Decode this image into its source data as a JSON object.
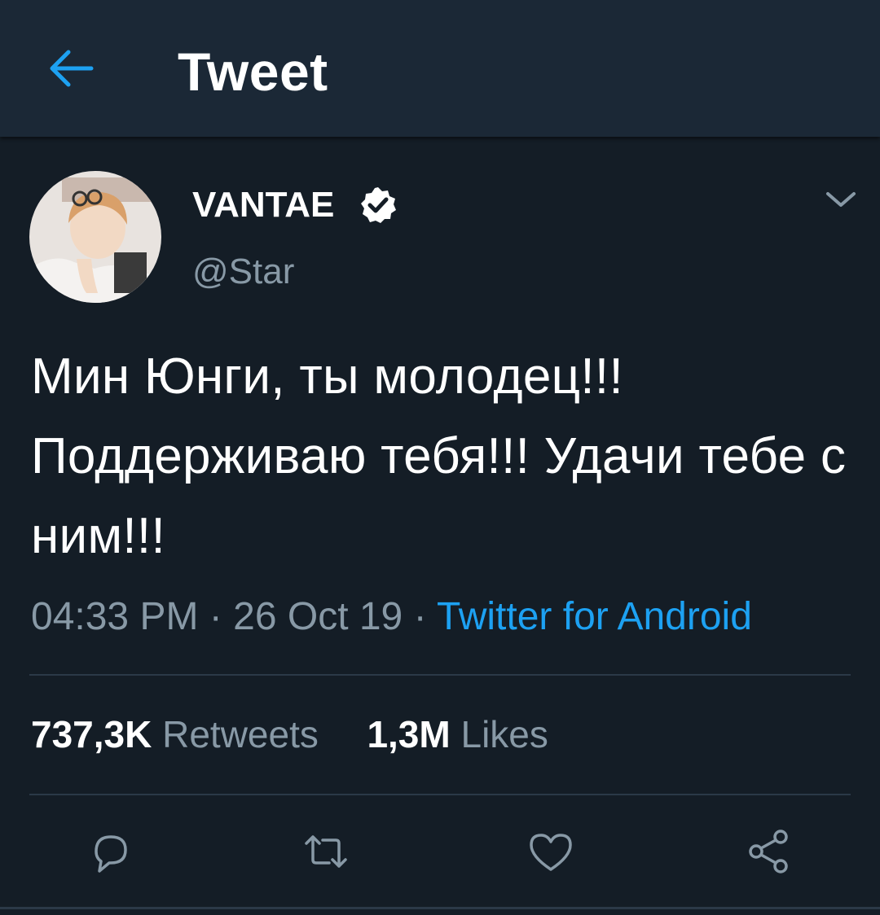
{
  "header": {
    "title": "Tweet",
    "back_icon": "arrow-left-icon",
    "accent_color": "#1da1f2"
  },
  "tweet": {
    "author": {
      "display_name": "VANTAE",
      "handle": "@Star",
      "verified": true,
      "avatar_icon": "user-avatar"
    },
    "text": "Мин Юнги, ты молодец!!! Поддерживаю тебя!!! Удачи тебе с ним!!!",
    "time": "04:33 PM",
    "date": "26 Oct 19",
    "separator": "·",
    "source": "Twitter for Android",
    "stats": {
      "retweets_count": "737,3K",
      "retweets_label": "Retweets",
      "likes_count": "1,3M",
      "likes_label": "Likes"
    },
    "actions": [
      "reply-icon",
      "retweet-icon",
      "like-icon",
      "share-icon"
    ]
  },
  "colors": {
    "background": "#141d26",
    "header_background": "#1b2836",
    "secondary_text": "#8899a6",
    "link": "#1da1f2"
  }
}
